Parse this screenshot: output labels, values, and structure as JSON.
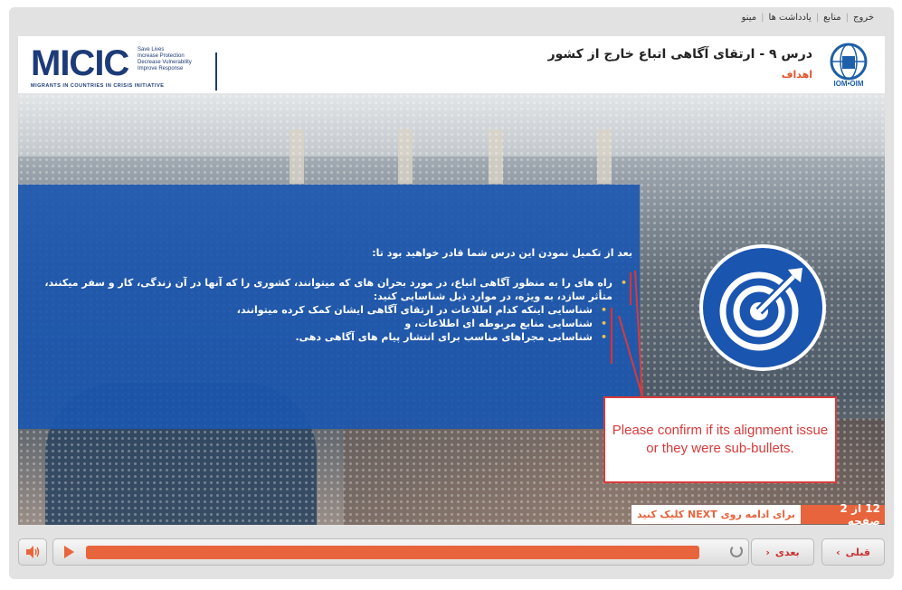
{
  "topnav": {
    "items": [
      "خروج",
      "منابع",
      "یادداشت ها",
      "مینو"
    ]
  },
  "header": {
    "course_title": "درس ۹ - ارتقای آگاهی اتباع خارج از کشور",
    "course_subtitle": "اهداف",
    "partner_logo": {
      "word": "MICIC",
      "tagline": [
        "Save Lives",
        "Increase Protection",
        "Decrease Vulnerability",
        "Improve Response"
      ],
      "subtitle": "MIGRANTS IN COUNTRIES IN CRISIS INITIATIVE"
    },
    "org_logo": {
      "text": "IOM•OIM"
    }
  },
  "content": {
    "lead": "بعد از تکمیل نمودن این درس شما قادر خواهید بود تا:",
    "bullet": "راه های را به منظور آگاهی اتباع، در مورد بحران های که میتوانند، کشوری را که آنها در آن زندگی، کار و سفر میکنند، متأثر سازد، به ویژه، در موارد ذیل شناسایی کنید:",
    "sub_bullets": [
      "شناسایی اینکه کدام اطلاعات در ارتقای آگاهی ایشان کمک کرده میتوانند،",
      "شناسایی منابع مربوطه ای اطلاعات، و",
      "شناسایی مجراهای مناسب برای انتشار پیام های آگاهی دهی."
    ]
  },
  "callout": {
    "text": "Please confirm if its alignment issue or they were sub-bullets."
  },
  "status": {
    "slide_counter": "12 از 2 صفحه",
    "next_hint": "برای ادامه روی NEXT کلیک کنید"
  },
  "controls": {
    "prev_label": "قبلی",
    "next_label": "بعدی",
    "progress": 0.88
  },
  "colors": {
    "accent": "#e8643c",
    "blue": "#1a55b0",
    "callout": "#d93a3a"
  },
  "icons": [
    "volume-icon",
    "play-icon",
    "replay-icon",
    "chevron-left-icon",
    "chevron-right-icon",
    "target-icon"
  ]
}
